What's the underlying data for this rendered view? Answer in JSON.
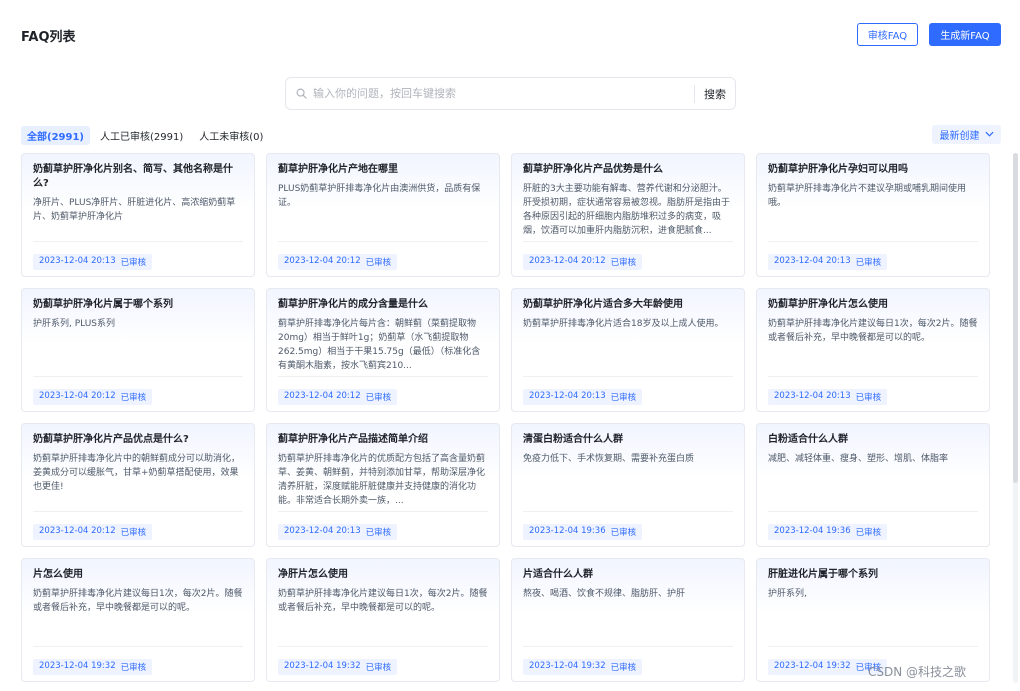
{
  "header": {
    "title": "FAQ列表",
    "review_button": "审核FAQ",
    "generate_button": "生成新FAQ"
  },
  "search": {
    "placeholder": "输入你的问题，按回车键搜索",
    "button": "搜索"
  },
  "tabs": [
    {
      "label": "全部(2991)",
      "active": true
    },
    {
      "label": "人工已审核(2991)",
      "active": false
    },
    {
      "label": "人工未审核(0)",
      "active": false
    }
  ],
  "sort": {
    "label": "最新创建"
  },
  "cards": [
    {
      "question": "奶蓟草护肝净化片别名、简写、其他名称是什么?",
      "answer": "净肝片、PLUS净肝片、肝脏进化片、高浓缩奶蓟草片、奶蓟草护肝净化片",
      "date": "2023-12-04 20:13",
      "status": "已审核"
    },
    {
      "question": "蓟草护肝净化片产地在哪里",
      "answer": "PLUS奶蓟草护肝排毒净化片由澳洲供货，品质有保证。",
      "date": "2023-12-04 20:12",
      "status": "已审核"
    },
    {
      "question": "蓟草护肝净化片产品优势是什么",
      "answer": "肝脏的3大主要功能有解毒、营养代谢和分泌胆汁。肝受损初期，症状通常容易被忽视。脂肪肝是指由于各种原因引起的肝细胞内脂肪堆积过多的病变，吸烟，饮酒可以加重肝内脂肪沉积，进食肥腻食...",
      "date": "2023-12-04 20:12",
      "status": "已审核"
    },
    {
      "question": "奶蓟草护肝净化片孕妇可以用吗",
      "answer": "奶蓟草护肝排毒净化片不建议孕期或哺乳期间使用哦。",
      "date": "2023-12-04 20:13",
      "status": "已审核"
    },
    {
      "question": "奶蓟草护肝净化片属于哪个系列",
      "answer": "护肝系列, PLUS系列",
      "date": "2023-12-04 20:12",
      "status": "已审核"
    },
    {
      "question": "蓟草护肝净化片的成分含量是什么",
      "answer": "蓟草护肝排毒净化片每片含：朝鲜蓟（菜蓟提取物20mg）相当于鲜叶1g；奶蓟草（水飞蓟提取物262.5mg）相当于干果15.75g（最低）（标准化含有黄酮木脂素，按水飞蓟宾210...",
      "date": "2023-12-04 20:12",
      "status": "已审核"
    },
    {
      "question": "奶蓟草护肝净化片适合多大年龄使用",
      "answer": "奶蓟草护肝排毒净化片适合18岁及以上成人使用。",
      "date": "2023-12-04 20:13",
      "status": "已审核"
    },
    {
      "question": "奶蓟草护肝净化片怎么使用",
      "answer": "奶蓟草护肝排毒净化片建议每日1次，每次2片。随餐或者餐后补充，早中晚餐都是可以的呢。",
      "date": "2023-12-04 20:13",
      "status": "已审核"
    },
    {
      "question": "奶蓟草护肝净化片产品优点是什么?",
      "answer": "奶蓟草护肝排毒净化片中的朝鲜蓟成分可以助消化，姜黄成分可以缓胀气，甘草+奶蓟草搭配使用，效果也更佳!",
      "date": "2023-12-04 20:12",
      "status": "已审核"
    },
    {
      "question": "蓟草护肝净化片产品描述简单介绍",
      "answer": "奶蓟草护肝排毒净化片的优质配方包括了高含量奶蓟草、姜黄、朝鲜蓟，并特别添加甘草，帮助深层净化清养肝脏，深度赋能肝脏健康并支持健康的消化功能。非常适合长期外卖一族，...",
      "date": "2023-12-04 20:13",
      "status": "已审核"
    },
    {
      "question": "清蛋白粉适合什么人群",
      "answer": "免疫力低下、手术恢复期、需要补充蛋白质",
      "date": "2023-12-04 19:36",
      "status": "已审核"
    },
    {
      "question": "白粉适合什么人群",
      "answer": "减肥、减轻体重、瘦身、塑形、增肌、体脂率",
      "date": "2023-12-04 19:36",
      "status": "已审核"
    },
    {
      "question": "片怎么使用",
      "answer": "奶蓟草护肝排毒净化片建议每日1次，每次2片。随餐或者餐后补充，早中晚餐都是可以的呢。",
      "date": "2023-12-04 19:32",
      "status": "已审核"
    },
    {
      "question": "净肝片怎么使用",
      "answer": "奶蓟草护肝排毒净化片建议每日1次，每次2片。随餐或者餐后补充，早中晚餐都是可以的呢。",
      "date": "2023-12-04 19:32",
      "status": "已审核"
    },
    {
      "question": "片适合什么人群",
      "answer": "熬夜、喝酒、饮食不规律、脂肪肝、护肝",
      "date": "2023-12-04 19:32",
      "status": "已审核"
    },
    {
      "question": "肝脏进化片属于哪个系列",
      "answer": "护肝系列,",
      "date": "2023-12-04 19:32",
      "status": "已审核"
    }
  ],
  "watermark": "CSDN @科技之歌",
  "colors": {
    "accent": "#2f6bff",
    "badge_bg": "#eef3ff"
  }
}
